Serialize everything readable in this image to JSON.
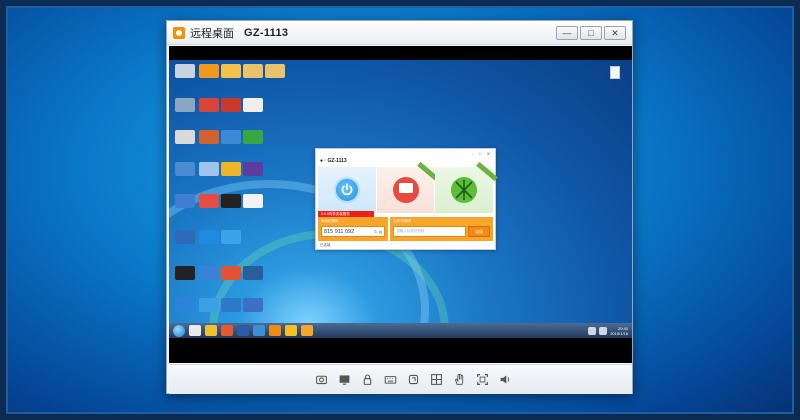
{
  "window": {
    "title": "远程桌面",
    "device_name": "GZ-1113",
    "controls": [
      "minimize-icon",
      "restore-icon",
      "close-icon"
    ]
  },
  "client": {
    "device_line": "● · GZ-1113",
    "remote_code_label": "本机识别码",
    "remote_code": "815 911 092",
    "connect_label": "伙伴识别码",
    "connect_placeholder": "请输入伙伴识别码",
    "connect_button": "连接",
    "alert_text": "5.0.0向导安装服务",
    "status_text": "已连接"
  },
  "taskbar": {
    "clock_time": "20:40",
    "clock_date": "2015/1/16"
  },
  "toolbar": {
    "tools": [
      "screenshot-icon",
      "display-icon",
      "lock-icon",
      "keyboard-icon",
      "ctrl-alt-del-icon",
      "grid-icon",
      "hand-icon",
      "fullscreen-icon",
      "sound-icon"
    ]
  },
  "colors": {
    "orange_accent": "#f7a52b",
    "window_bg": "#f2f4f7",
    "desktop_blue": "#1a76c4"
  }
}
